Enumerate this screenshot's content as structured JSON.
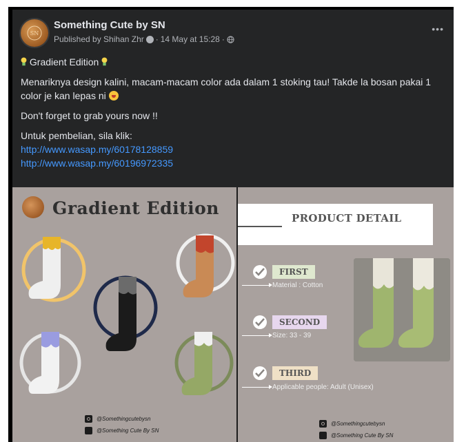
{
  "post": {
    "page_name": "Something Cute by SN",
    "published_by": "Published by Shihan Zhr",
    "timestamp": "14 May at 15:28",
    "more_label": "•••",
    "headline": "Gradient Edition",
    "paragraph1": "Menariknya design kalini, macam-macam color ada dalam 1 stoking tau! Takde la bosan pakai 1 color je kan lepas ni",
    "paragraph2": "Don't forget to grab yours now !!",
    "paragraph3": "Untuk pembelian, sila klik:",
    "link1": "http://www.wasap.my/60178128859",
    "link2": "http://www.wasap.my/60196972335"
  },
  "image_left": {
    "title": "Gradient Edition",
    "instagram_handle": "@Somethingcutebysn",
    "facebook_handle": "@Something Cute By SN"
  },
  "image_right": {
    "title": "PRODUCT DETAIL",
    "items": [
      {
        "tag": "FIRST",
        "detail": "Material : Cotton",
        "tag_color": "#dfe8cf"
      },
      {
        "tag": "SECOND",
        "detail": "Size: 33 - 39",
        "tag_color": "#e7d7ee"
      },
      {
        "tag": "THIRD",
        "detail": "Applicable people: Adult (Unisex)",
        "tag_color": "#efe0c6"
      }
    ],
    "instagram_handle": "@Somethingcutebysn",
    "facebook_handle": "@Something Cute By SN"
  },
  "colors": {
    "post_bg": "#242526",
    "link": "#4599ff",
    "image_bg": "#a9a19e"
  }
}
